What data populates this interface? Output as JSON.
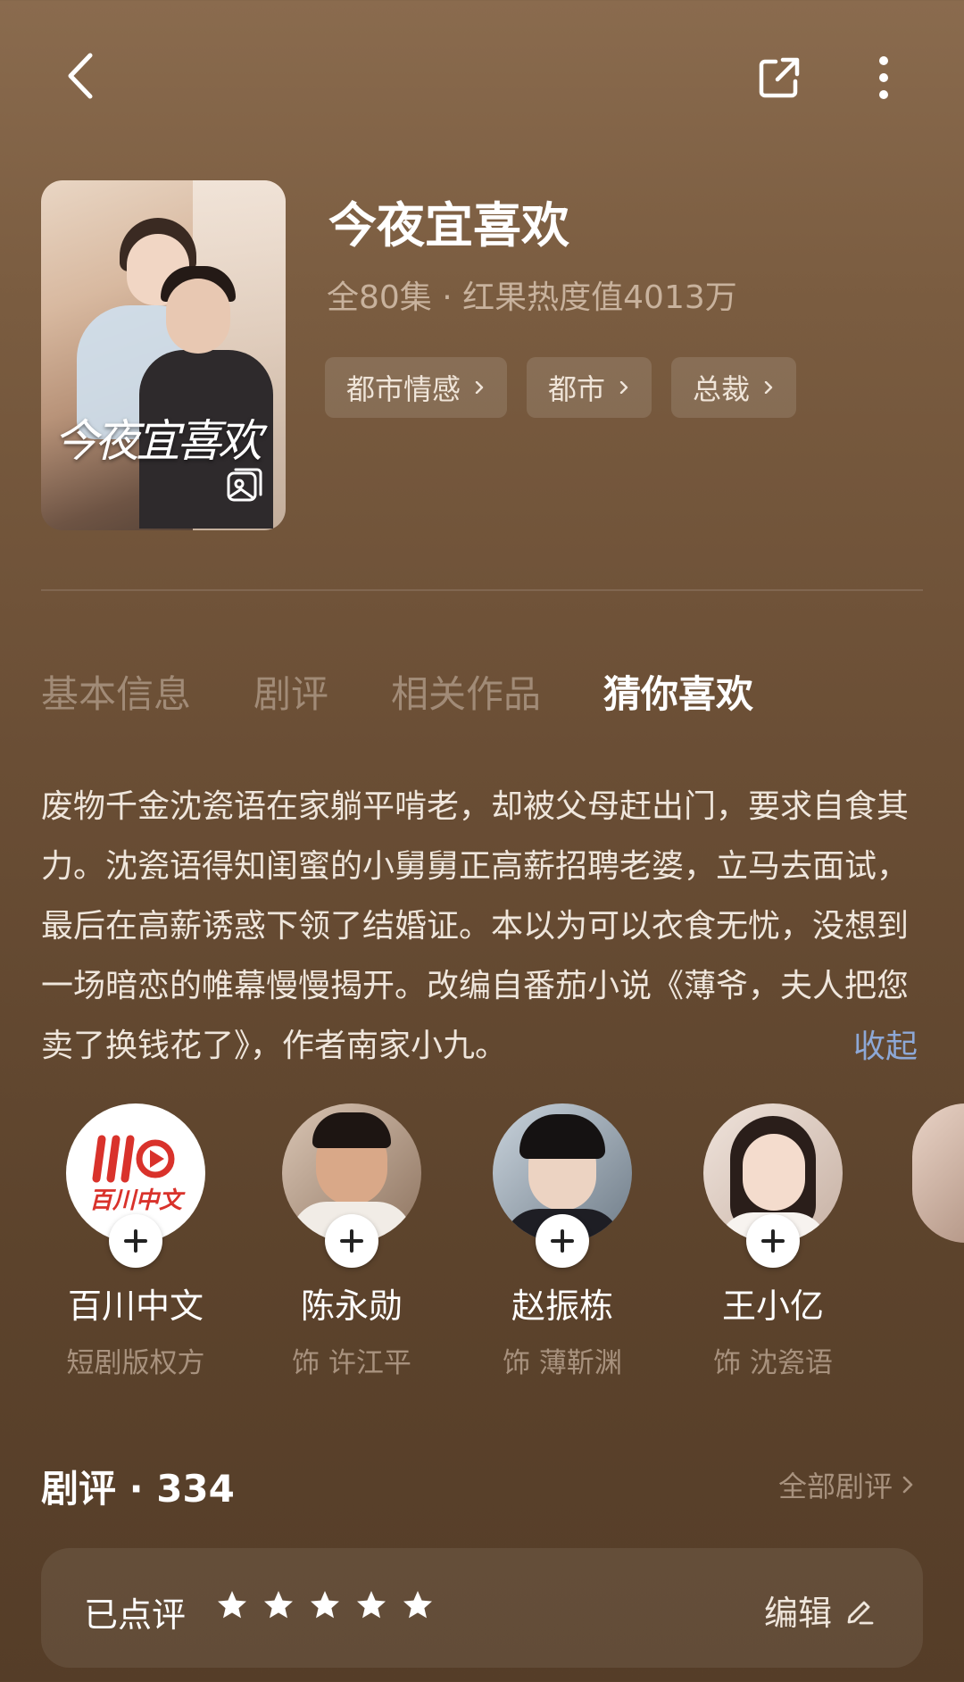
{
  "drama": {
    "title": "今夜宜喜欢",
    "meta": "全80集 · 红果热度值4013万",
    "cover_title": "今夜宜喜欢",
    "tags": [
      "都市情感",
      "都市",
      "总裁"
    ]
  },
  "tabs": [
    "基本信息",
    "剧评",
    "相关作品",
    "猜你喜欢"
  ],
  "active_tab": "猜你喜欢",
  "synopsis": "废物千金沈瓷语在家躺平啃老，却被父母赶出门，要求自食其力。沈瓷语得知闺蜜的小舅舅正高薪招聘老婆，立马去面试，最后在高薪诱惑下领了结婚证。本以为可以衣食无忧，没想到一场暗恋的帷幕慢慢揭开。改编自番茄小说《薄爷，夫人把您卖了换钱花了》，作者南家小九。",
  "collapse_label": "收起",
  "people": [
    {
      "name": "百川中文",
      "role": "短剧版权方",
      "logo_text": "百川中文"
    },
    {
      "name": "陈永勋",
      "role": "饰 许江平"
    },
    {
      "name": "赵振栋",
      "role": "饰 薄靳渊"
    },
    {
      "name": "王小亿",
      "role": "饰 沈瓷语"
    }
  ],
  "reviews": {
    "heading": "剧评 · 334",
    "all_label": "全部剧评",
    "rated_label": "已点评",
    "stars": 5,
    "edit_label": "编辑"
  },
  "colors": {
    "accent_link": "#8da8d6",
    "muted_text": "#a8927e",
    "brand_red": "#d9322b"
  },
  "icons": [
    "back-arrow-icon",
    "share-icon",
    "more-vertical-icon",
    "chevron-right-icon",
    "plus-icon",
    "star-icon",
    "pencil-icon",
    "gallery-icon"
  ]
}
